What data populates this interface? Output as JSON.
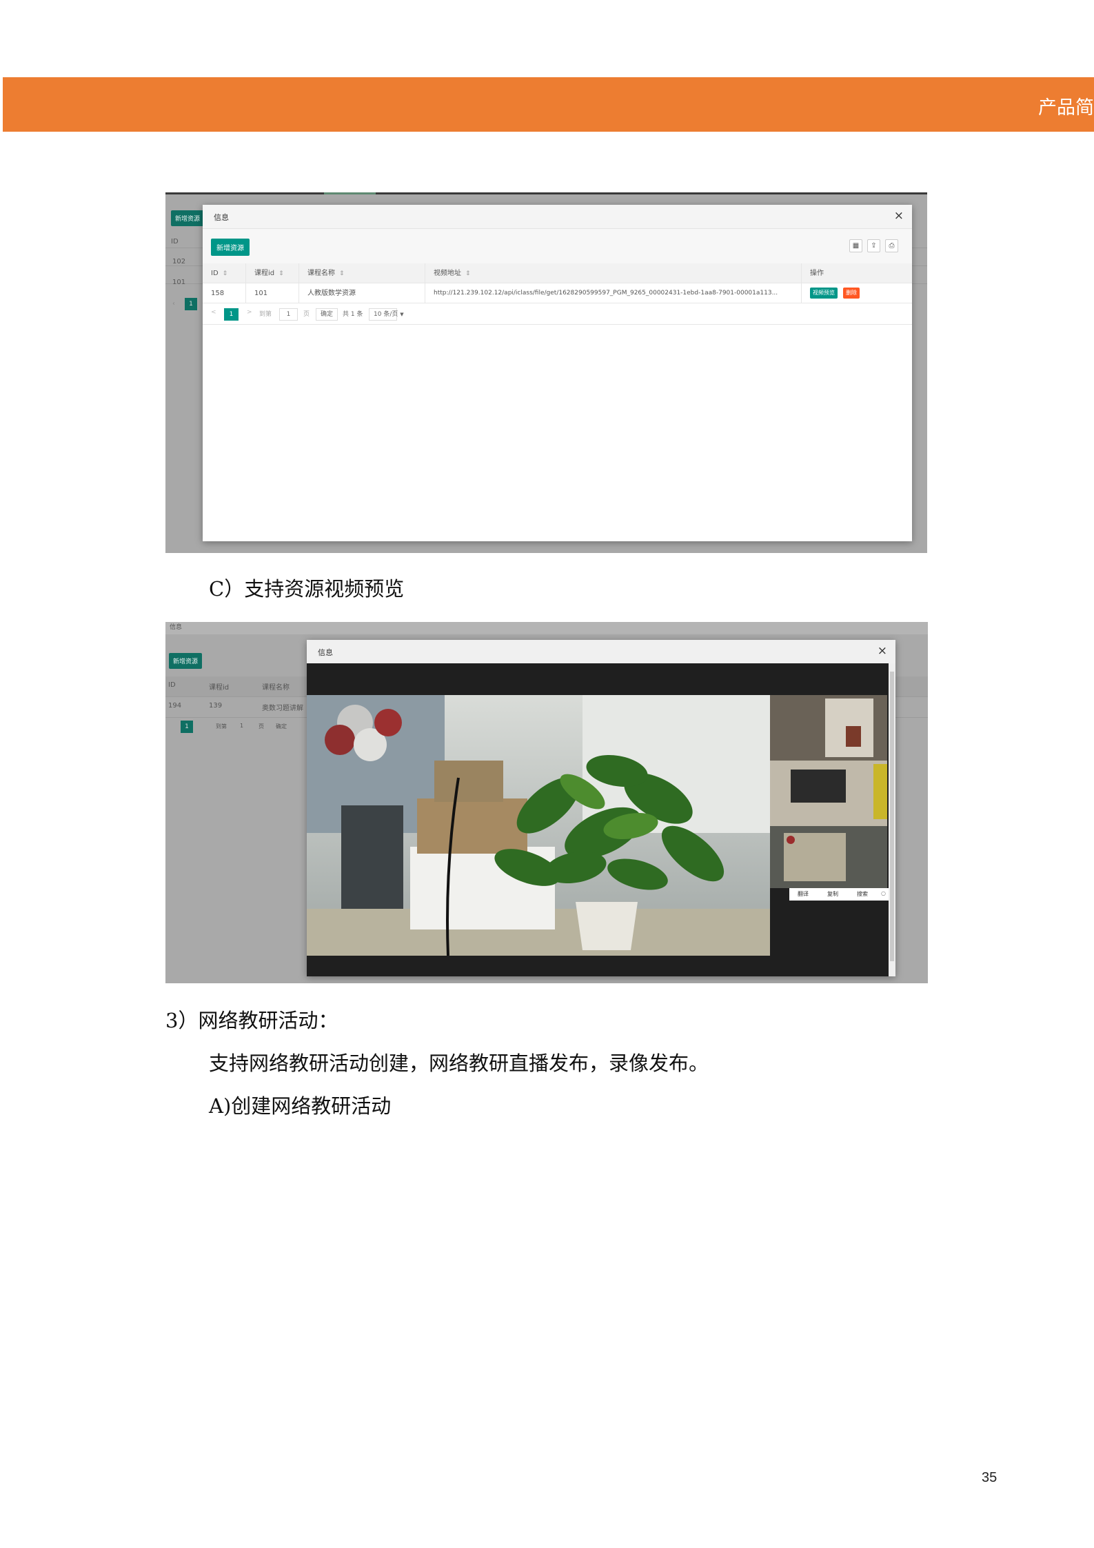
{
  "header": {
    "title": "产品简"
  },
  "screenshot1": {
    "bg_add_button": "新增资源",
    "bg_id_header": "ID",
    "bg_rows": [
      "102",
      "101"
    ],
    "bg_page": "1",
    "dialog": {
      "title": "信息",
      "close": "×",
      "add_button": "新增资源",
      "toolbar_icons": [
        "columns-icon",
        "export-icon",
        "print-icon"
      ],
      "columns": [
        "ID",
        "课程id",
        "课程名称",
        "视频地址",
        "操作"
      ],
      "rows": [
        {
          "id": "158",
          "course_id": "101",
          "course_name": "人教版数学资源",
          "video_url": "http://121.239.102.12/api/iclass/file/get/1628290599597_PGM_9265_00002431-1ebd-1aa8-7901-00001a113...",
          "actions": [
            "视频预览",
            "删除"
          ]
        }
      ],
      "pager": {
        "prev": "<",
        "current": "1",
        "next": ">",
        "goto_label": "到第",
        "goto_value": "1",
        "page_unit": "页",
        "confirm": "确定",
        "total": "共 1 条",
        "per_page": "10 条/页"
      }
    }
  },
  "caption1": "C）支持资源视频预览",
  "screenshot2": {
    "bg_title": "信息",
    "bg_add_button": "新增资源",
    "bg_columns": [
      "ID",
      "课程id",
      "课程名称"
    ],
    "bg_row": [
      "194",
      "139",
      "奥数习题讲解"
    ],
    "bg_pager": {
      "current": "1",
      "goto_label": "到第",
      "goto_value": "1",
      "page_unit": "页",
      "confirm": "确定"
    },
    "dialog": {
      "title": "信息",
      "close": "×",
      "context_menu": [
        "翻译",
        "复制",
        "搜索"
      ]
    }
  },
  "section3": {
    "heading": "3）网络教研活动：",
    "paragraph": "支持网络教研活动创建，网络教研直播发布，录像发布。",
    "item_a": "A)创建网络教研活动"
  },
  "page_number": "35",
  "colors": {
    "header": "#ed7d31",
    "accent_green": "#009688",
    "danger": "#ff5722"
  }
}
